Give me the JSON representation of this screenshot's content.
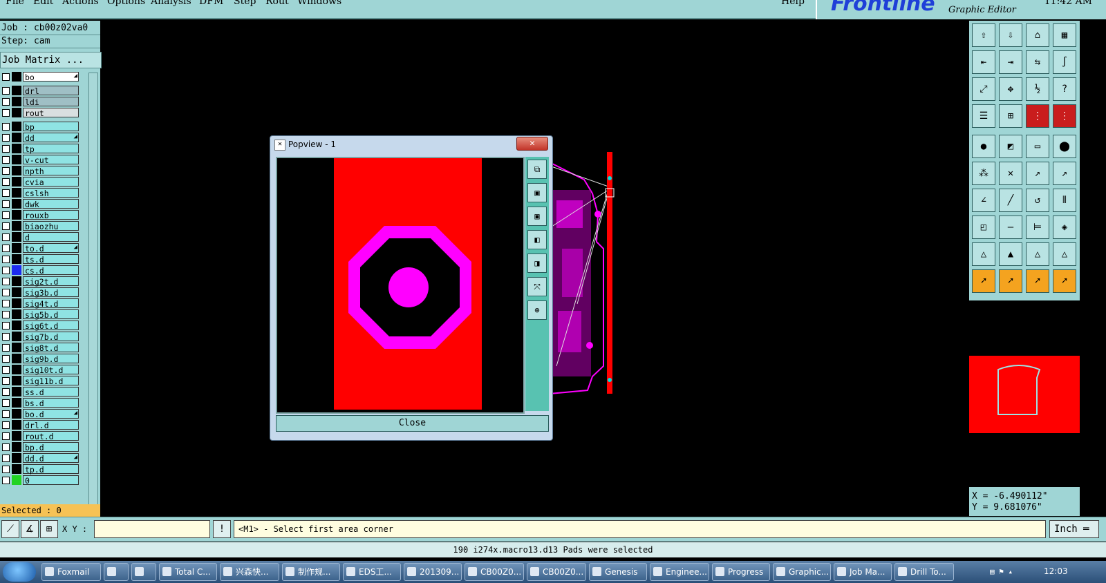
{
  "menu": {
    "items": [
      "File",
      "Edit",
      "Actions",
      "Options",
      "Analysis",
      "DFM",
      "Step",
      "Rout",
      "Windows"
    ],
    "help": "Help"
  },
  "brand": {
    "logo": "Frontline",
    "subtitle": "Graphic Editor",
    "clock": "11:42 AM"
  },
  "job": {
    "job_line": "Job : cb00z02va0",
    "step_line": "Step: cam",
    "matrix_button": "Job Matrix ..."
  },
  "layers": [
    {
      "name": "bo",
      "color": "#ffffff",
      "mark": "◢"
    },
    {
      "name": "drl",
      "color": "#9fbfc5"
    },
    {
      "name": "ldi",
      "color": "#9fbfc5"
    },
    {
      "name": "rout",
      "color": "#d9dfe0"
    },
    {
      "name": "bp",
      "color": "#8fe3e3"
    },
    {
      "name": "dd",
      "color": "#8fe3e3",
      "mark": "◢"
    },
    {
      "name": "tp",
      "color": "#8fe3e3"
    },
    {
      "name": "v-cut",
      "color": "#8fe3e3"
    },
    {
      "name": "npth",
      "color": "#8fe3e3"
    },
    {
      "name": "cvia",
      "color": "#8fe3e3"
    },
    {
      "name": "cslsh",
      "color": "#8fe3e3"
    },
    {
      "name": "dwk",
      "color": "#8fe3e3"
    },
    {
      "name": "rouxb",
      "color": "#8fe3e3"
    },
    {
      "name": "biaozhu",
      "color": "#8fe3e3"
    },
    {
      "name": "d",
      "color": "#8fe3e3"
    },
    {
      "name": "to.d",
      "color": "#8fe3e3",
      "mark": "◢"
    },
    {
      "name": "ts.d",
      "color": "#8fe3e3"
    },
    {
      "name": "cs.d",
      "color": "#8fe3e3",
      "swatch": "#1d2cf0"
    },
    {
      "name": "sig2t.d",
      "color": "#8fe3e3"
    },
    {
      "name": "sig3b.d",
      "color": "#8fe3e3"
    },
    {
      "name": "sig4t.d",
      "color": "#8fe3e3"
    },
    {
      "name": "sig5b.d",
      "color": "#8fe3e3"
    },
    {
      "name": "sig6t.d",
      "color": "#8fe3e3"
    },
    {
      "name": "sig7b.d",
      "color": "#8fe3e3"
    },
    {
      "name": "sig8t.d",
      "color": "#8fe3e3"
    },
    {
      "name": "sig9b.d",
      "color": "#8fe3e3"
    },
    {
      "name": "sig10t.d",
      "color": "#8fe3e3"
    },
    {
      "name": "sig11b.d",
      "color": "#8fe3e3"
    },
    {
      "name": "ss.d",
      "color": "#8fe3e3"
    },
    {
      "name": "bs.d",
      "color": "#8fe3e3"
    },
    {
      "name": "bo.d",
      "color": "#8fe3e3",
      "mark": "◢"
    },
    {
      "name": "drl.d",
      "color": "#8fe3e3"
    },
    {
      "name": "rout.d",
      "color": "#8fe3e3"
    },
    {
      "name": "bp.d",
      "color": "#8fe3e3"
    },
    {
      "name": "dd.d",
      "color": "#8fe3e3",
      "mark": "◢"
    },
    {
      "name": "tp.d",
      "color": "#8fe3e3"
    },
    {
      "name": "0",
      "color": "#8fe3e3",
      "swatch": "#22d322"
    }
  ],
  "selected": "Selected : 0",
  "popview": {
    "title": "Popview - 1",
    "close_label": "Close",
    "close_x": "✕"
  },
  "status": {
    "xy_label": "X Y :",
    "xy_value": "",
    "prompt": "<M1> - Select first area corner",
    "unit": "Inch ═",
    "message": "190 i274x.macro13.d13 Pads were selected"
  },
  "coords": {
    "x": "X = -6.490112\"",
    "y": "Y = 9.681076\""
  },
  "taskbar": {
    "items": [
      "Foxmail",
      "",
      "",
      "Total C...",
      "兴森快...",
      "制作规...",
      "EDS工...",
      "201309...",
      "CB00Z0...",
      "CB00Z0...",
      "Genesis",
      "Enginee...",
      "Progress",
      "Graphic...",
      "Job Ma...",
      "Drill To..."
    ],
    "clock": "12:03"
  },
  "colors": {
    "panel": "#9fd5d5",
    "pad": "#ff00ff",
    "copper": "#ff0000"
  }
}
